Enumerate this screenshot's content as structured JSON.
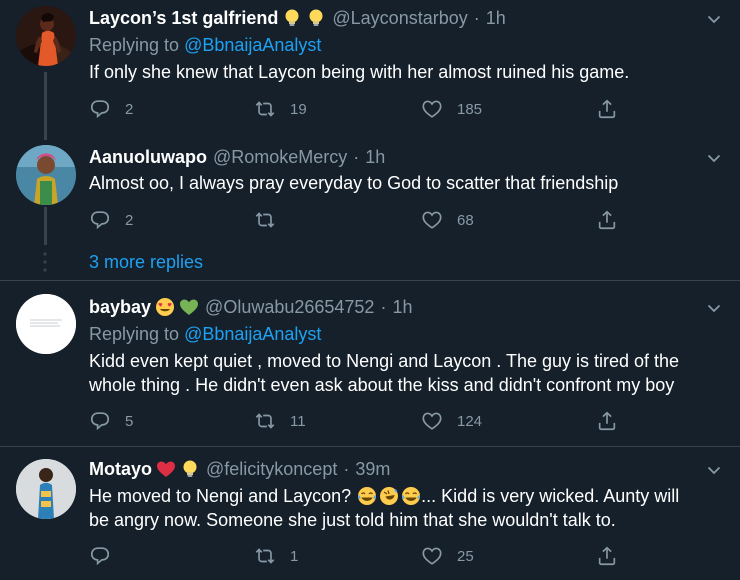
{
  "tweets": [
    {
      "name": "Laycon’s 1st galfriend",
      "handle": "@Layconstarboy",
      "time": "1h",
      "replying_prefix": "Replying to",
      "replying_to": "@BbnaijaAnalyst",
      "text": "If only she knew that Laycon being with her almost ruined his game.",
      "replies": "2",
      "retweets": "19",
      "likes": "185"
    },
    {
      "name": "Aanuoluwapo",
      "handle": "@RomokeMercy",
      "time": "1h",
      "text": "Almost oo, I always pray everyday to God to scatter that friendship",
      "replies": "2",
      "retweets": "",
      "likes": "68"
    },
    {
      "name": "baybay",
      "handle": "@Oluwabu26654752",
      "time": "1h",
      "replying_prefix": "Replying to",
      "replying_to": "@BbnaijaAnalyst",
      "text_lines": [
        "Kidd even kept quiet , moved to Nengi and Laycon . The guy is tired of the",
        "whole thing . He didn't even ask about the kiss and didn't confront my boy"
      ],
      "replies": "5",
      "retweets": "11",
      "likes": "124"
    },
    {
      "name": "Motayo",
      "handle": "@felicitykoncept",
      "time": "39m",
      "text_line1_start": "He moved to Nengi and Laycon?",
      "text_line1_end": "... Kidd is very wicked. Aunty will",
      "text_line2": "be angry now. Someone she just told him that she wouldn't talk to.",
      "replies": "",
      "retweets": "1",
      "likes": "25"
    }
  ],
  "more_replies": "3 more replies",
  "colors": {
    "background": "#15202b",
    "secondary_text": "#8899a6",
    "link": "#1da1f2",
    "divider": "#38444d"
  },
  "icons": [
    "reply-icon",
    "retweet-icon",
    "like-icon",
    "share-icon",
    "chevron-down-icon",
    "lightbulb-icon",
    "heart-eyes-emoji",
    "green-heart-emoji",
    "red-heart-emoji",
    "tears-of-joy-emoji",
    "rofl-emoji"
  ]
}
